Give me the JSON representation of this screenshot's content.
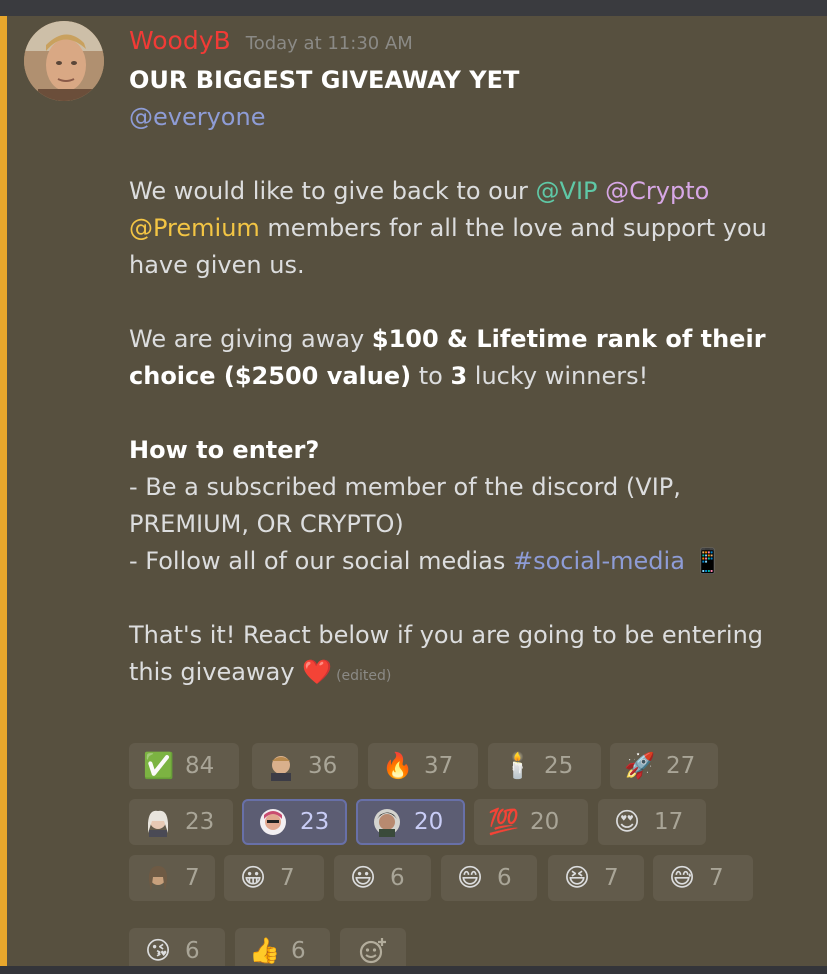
{
  "message": {
    "username": "WoodyB",
    "timestamp": "Today at 11:30 AM",
    "title": "OUR BIGGEST GIVEAWAY YET",
    "everyone": "@everyone",
    "p1_lead": "We would like to give back to our ",
    "vip": "@VIP",
    "crypto": "@Crypto",
    "premium": "@Premium",
    "p1_tail": " members for all the love and support you have given us.",
    "p2_lead": "We are giving away ",
    "p2_bold1": "$100 & Lifetime rank of their choice ($2500 value)",
    "p2_mid": " to ",
    "p2_bold2": "3",
    "p2_tail": " lucky winners!",
    "how_heading": "How to enter?",
    "rule1": "- Be a subscribed member of the discord (VIP, PREMIUM, OR CRYPTO)",
    "rule2_lead": "- Follow all of our social medias ",
    "rule2_channel": "#social-media",
    "rule2_emoji": "📱",
    "closing": "That's it! React below if you are going to be entering this giveaway ",
    "closing_emoji": "❤️",
    "edited": "(edited)"
  },
  "reactions": [
    {
      "emoji": "✅",
      "icon": "check-mark-icon",
      "count": "84"
    },
    {
      "emoji": "",
      "icon": "avatar-face-emoji-1",
      "count": "36"
    },
    {
      "emoji": "🔥",
      "icon": "fire-icon",
      "count": "37"
    },
    {
      "emoji": "🕯️",
      "icon": "candle-icon",
      "count": "25"
    },
    {
      "emoji": "🚀",
      "icon": "rocket-icon",
      "count": "27"
    },
    {
      "emoji": "",
      "icon": "avatar-face-emoji-2",
      "count": "23"
    },
    {
      "emoji": "",
      "icon": "avatar-face-emoji-3",
      "count": "23",
      "me": true
    },
    {
      "emoji": "",
      "icon": "avatar-face-emoji-4",
      "count": "20",
      "me": true
    },
    {
      "emoji": "💯",
      "icon": "hundred-points-icon",
      "count": "20"
    },
    {
      "emoji": "😍",
      "icon": "heart-eyes-icon",
      "count": "17"
    },
    {
      "emoji": "",
      "icon": "avatar-face-emoji-5",
      "count": "7"
    },
    {
      "emoji": "😀",
      "icon": "grinning-face-icon",
      "count": "7"
    },
    {
      "emoji": "😃",
      "icon": "smiley-face-icon",
      "count": "6"
    },
    {
      "emoji": "😄",
      "icon": "smile-face-icon",
      "count": "6"
    },
    {
      "emoji": "😆",
      "icon": "laughing-face-icon",
      "count": "7"
    },
    {
      "emoji": "😅",
      "icon": "sweat-smile-icon",
      "count": "7"
    },
    {
      "emoji": "😘",
      "icon": "kiss-face-icon",
      "count": "6"
    },
    {
      "emoji": "👍",
      "icon": "thumbs-up-icon",
      "count": "6"
    }
  ],
  "colors": {
    "background": "#57503f",
    "accent": "#e8a72c",
    "username": "#f13b36",
    "mention_blue": "#8e9cd6"
  }
}
